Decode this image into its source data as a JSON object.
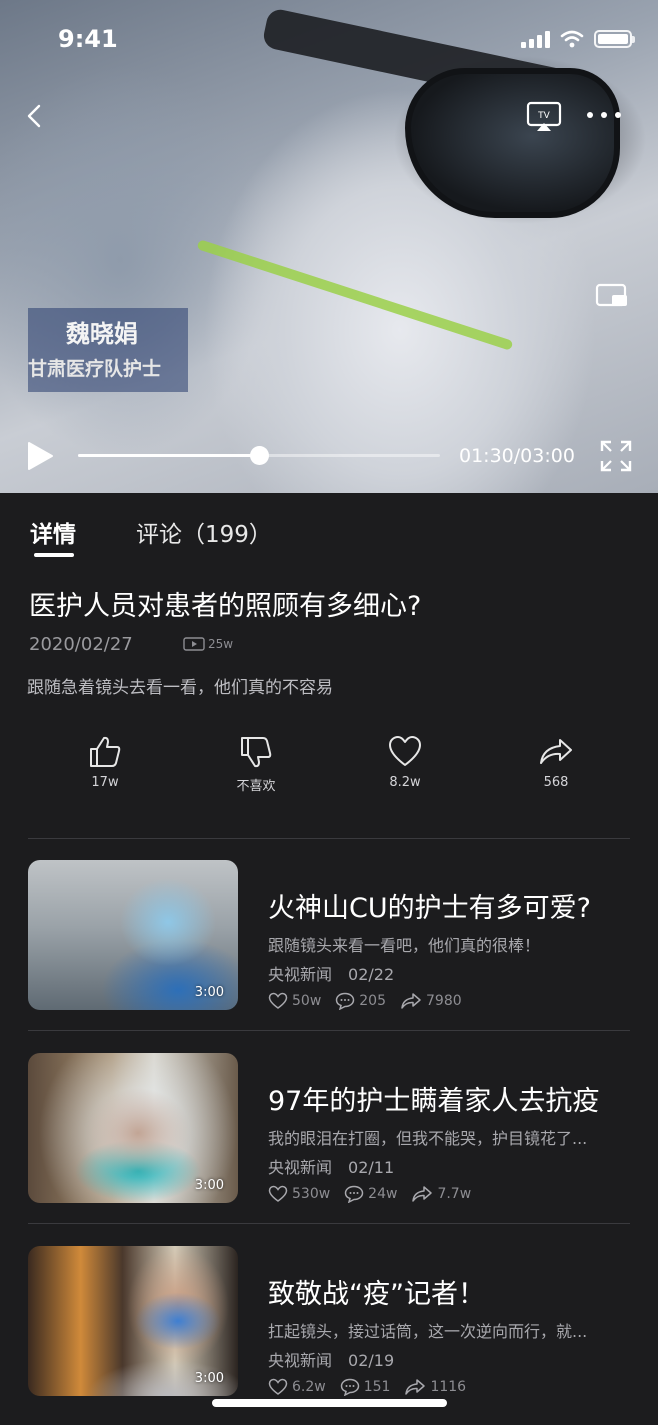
{
  "status_bar": {
    "time": "9:41"
  },
  "player": {
    "overlay_name": "魏晓娟",
    "overlay_caption": "甘肃医疗队护士",
    "timecode": "01:30/03:00",
    "progress_fraction": 0.5
  },
  "tabs": [
    {
      "label": "详情",
      "active": true
    },
    {
      "label": "评论（199）",
      "active": false
    }
  ],
  "video": {
    "title": "医护人员对患者的照顾有多细心?",
    "date": "2020/02/27",
    "views": "25w",
    "description": "跟随急着镜头去看一看，他们真的不容易"
  },
  "actions": [
    {
      "icon": "thumbs-up-icon",
      "label": "17w"
    },
    {
      "icon": "thumbs-down-icon",
      "label": "不喜欢"
    },
    {
      "icon": "heart-icon",
      "label": "8.2w"
    },
    {
      "icon": "share-icon",
      "label": "568"
    }
  ],
  "feed": [
    {
      "title": "火神山CU的护士有多可爱?",
      "description": "跟随镜头来看一看吧，他们真的很棒！",
      "source": "央视新闻",
      "date": "02/22",
      "duration": "3:00",
      "likes": "50w",
      "comments": "205",
      "shares": "7980"
    },
    {
      "title": "97年的护士瞒着家人去抗疫",
      "description": "我的眼泪在打圈，但我不能哭，护目镜花了...",
      "source": "央视新闻",
      "date": "02/11",
      "duration": "3:00",
      "likes": "530w",
      "comments": "24w",
      "shares": "7.7w"
    },
    {
      "title": "致敬战“疫”记者！",
      "description": "扛起镜头，接过话筒，这一次逆向而行，就...",
      "source": "央视新闻",
      "date": "02/19",
      "duration": "3:00",
      "likes": "6.2w",
      "comments": "151",
      "shares": "1116"
    }
  ],
  "colors": {
    "background": "#1c1c1e",
    "divider": "#3a3a3e",
    "text_secondary": "#a8a8ad"
  }
}
